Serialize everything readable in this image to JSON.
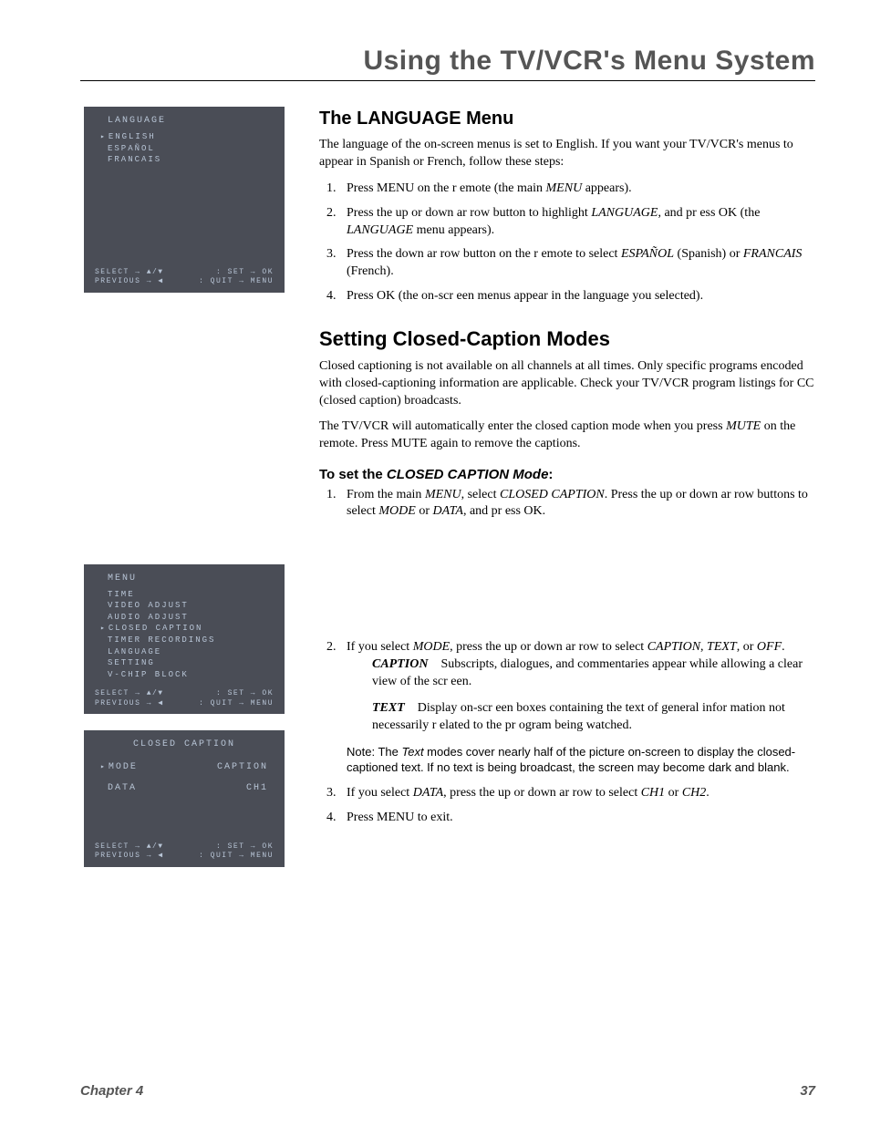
{
  "header": {
    "title": "Using the TV/VCR's Menu System"
  },
  "sidebar": {
    "osd1": {
      "title": "LANGUAGE",
      "items": [
        "ENGLISH",
        "ESPAÑOL",
        "FRANCAIS"
      ],
      "selected": 0,
      "foot_l1_left": "SELECT   → ▲/▼",
      "foot_l1_right": ": SET  → OK",
      "foot_l2_left": "PREVIOUS → ◀",
      "foot_l2_right": ": QUIT → MENU"
    },
    "osd2": {
      "title": "MENU",
      "items": [
        "TIME",
        "VIDEO ADJUST",
        "AUDIO ADJUST",
        "CLOSED CAPTION",
        "TIMER RECORDINGS",
        "LANGUAGE",
        "SETTING",
        "V-CHIP BLOCK"
      ],
      "selected": 3,
      "foot_l1_left": "SELECT   → ▲/▼",
      "foot_l1_right": ": SET  → OK",
      "foot_l2_left": "PREVIOUS → ◀",
      "foot_l2_right": ": QUIT → MENU"
    },
    "osd3": {
      "title": "CLOSED CAPTION",
      "rows": [
        {
          "k": "MODE",
          "v": "CAPTION",
          "sel": true
        },
        {
          "k": "DATA",
          "v": "CH1",
          "sel": false
        }
      ],
      "foot_l1_left": "SELECT   → ▲/▼",
      "foot_l1_right": ": SET  → OK",
      "foot_l2_left": "PREVIOUS → ◀",
      "foot_l2_right": ": QUIT → MENU"
    }
  },
  "main": {
    "s1_title": "The LANGUAGE Menu",
    "s1_p1": "The language of the on-screen menus is set to English. If you want your TV/VCR's menus to appear in Spanish or French, follow these steps:",
    "s1_li1_a": "Press MENU on the r emote (the main ",
    "s1_li1_b": "MENU",
    "s1_li1_c": " appears).",
    "s1_li2_a": "Press the up or down ar row button to highlight ",
    "s1_li2_b": "LANGUAGE",
    "s1_li2_c": ", and pr ess OK (the ",
    "s1_li2_d": "LANGUAGE",
    "s1_li2_e": " menu appears).",
    "s1_li3_a": "Press the down ar row button on the r emote to select ",
    "s1_li3_b": "ESPAÑOL",
    "s1_li3_c": " (Spanish) or ",
    "s1_li3_d": "FRANCAIS",
    "s1_li3_e": " (French).",
    "s1_li4": "Press OK (the on-scr een menus appear in the language you selected).",
    "s2_title": "Setting Closed-Caption Modes",
    "s2_p1": "Closed captioning is not available on all channels at all times. Only specific programs encoded with closed-captioning information are applicable. Check your TV/VCR program listings for CC (closed caption) broadcasts.",
    "s2_p2_a": "The TV/VCR will automatically enter the closed caption mode when you press ",
    "s2_p2_b": "MUTE",
    "s2_p2_c": " on the remote. Press MUTE again to remove the captions.",
    "s3_title_a": "To set the ",
    "s3_title_b": "CLOSED CAPTION Mode",
    "s3_title_c": ":",
    "s3_li1_a": "From the main ",
    "s3_li1_b": "MENU",
    "s3_li1_c": ", select ",
    "s3_li1_d": "CLOSED CAPTION",
    "s3_li1_e": ". Press the up or down ar row buttons to select ",
    "s3_li1_f": "MODE",
    "s3_li1_g": " or ",
    "s3_li1_h": "DATA",
    "s3_li1_i": ", and pr ess OK.",
    "s3_li2_a": "If you select ",
    "s3_li2_b": "MODE",
    "s3_li2_c": ", press the up or down ar row to select ",
    "s3_li2_d": "CAPTION",
    "s3_li2_e": ", ",
    "s3_li2_f": "TEXT",
    "s3_li2_g": ", or ",
    "s3_li2_h": "OFF",
    "s3_li2_i": ".",
    "def1_term": "CAPTION",
    "def1_text": "Subscripts, dialogues, and commentaries appear while allowing a clear view of the scr een.",
    "def2_term": "TEXT",
    "def2_text": "Display on-scr een boxes containing the text of general infor mation not necessarily r elated to the pr ogram being watched.",
    "note_a": "Note: The ",
    "note_b": "Text",
    "note_c": " modes cover nearly half of the picture on-screen to display the closed-captioned text. If no text is being broadcast, the screen may become dark and blank.",
    "s3_li3_a": "If you select ",
    "s3_li3_b": "DATA",
    "s3_li3_c": ", press the up or down ar row to select ",
    "s3_li3_d": "CH1",
    "s3_li3_e": " or ",
    "s3_li3_f": "CH2",
    "s3_li3_g": ".",
    "s3_li4": "Press MENU to exit."
  },
  "footer": {
    "chapter": "Chapter 4",
    "page": "37"
  }
}
